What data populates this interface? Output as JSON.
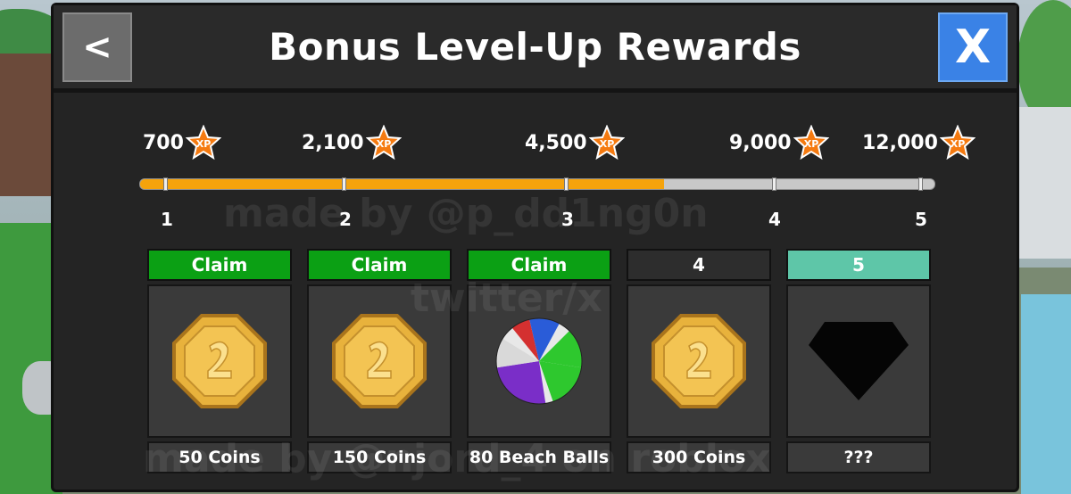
{
  "header": {
    "title": "Bonus Level-Up Rewards",
    "back_label": "<",
    "close_label": "X"
  },
  "progress": {
    "milestones": [
      {
        "xp": "700",
        "level": "1"
      },
      {
        "xp": "2,100",
        "level": "2"
      },
      {
        "xp": "4,500",
        "level": "3"
      },
      {
        "xp": "9,000",
        "level": "4"
      },
      {
        "xp": "12,000",
        "level": "5"
      }
    ],
    "fill_fraction": 0.66,
    "xp_icon_label": "XP",
    "fill_color": "#f5a30c",
    "track_color": "#c8c8c8"
  },
  "rewards": [
    {
      "status": "Claim",
      "label": "50 Coins",
      "icon": "coin-icon"
    },
    {
      "status": "Claim",
      "label": "150 Coins",
      "icon": "coin-icon"
    },
    {
      "status": "Claim",
      "label": "80 Beach Balls",
      "icon": "beach-ball-icon"
    },
    {
      "status": "4",
      "label": "300 Coins",
      "icon": "coin-icon"
    },
    {
      "status": "5",
      "label": "???",
      "icon": "mystery-gem-icon"
    }
  ],
  "watermarks": [
    "made by @p_dd1ng0n",
    "twitter/x",
    "made by @njord_4 on roblox"
  ],
  "colors": {
    "claim_green": "#0ba014",
    "next_teal": "#5ec6a8",
    "close_blue": "#3a82e6",
    "coin_gold": "#e8b23c"
  }
}
